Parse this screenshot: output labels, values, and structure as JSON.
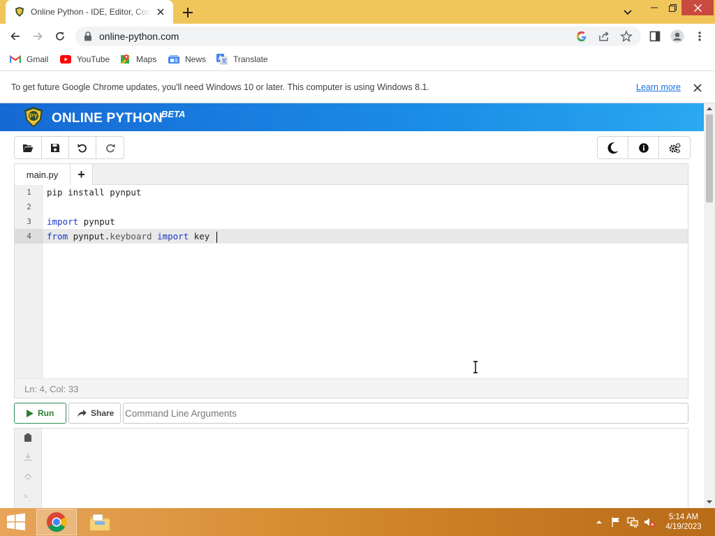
{
  "browser": {
    "tab_title": "Online Python - IDE, Editor, Compiler, Interpreter",
    "url": "online-python.com",
    "bookmarks": [
      {
        "label": "Gmail",
        "icon": "gmail-icon"
      },
      {
        "label": "YouTube",
        "icon": "youtube-icon"
      },
      {
        "label": "Maps",
        "icon": "maps-icon"
      },
      {
        "label": "News",
        "icon": "news-icon"
      },
      {
        "label": "Translate",
        "icon": "translate-icon"
      }
    ],
    "infobar": {
      "message": "To get future Google Chrome updates, you'll need Windows 10 or later. This computer is using Windows 8.1.",
      "link": "Learn more"
    }
  },
  "site": {
    "title": "ONLINE PYTHON",
    "badge": "BETA",
    "logo_text": "PY"
  },
  "editor": {
    "file_tab": "main.py",
    "add_tab": "+",
    "line_numbers": [
      "1",
      "2",
      "3",
      "4"
    ],
    "lines": [
      {
        "plain": "pip install pynput"
      },
      {
        "plain": ""
      },
      {
        "kw1": "import",
        "rest": " pynput"
      },
      {
        "kw1": "from",
        "mod": " pynput.",
        "attr": "keyboard",
        "kw2": " import",
        "rest": " key "
      }
    ],
    "status": "Ln: 4,  Col: 33"
  },
  "actions": {
    "run_label": "Run",
    "share_label": "Share",
    "cmd_placeholder": "Command Line Arguments"
  },
  "taskbar": {
    "time": "5:14 AM",
    "date": "4/19/2023"
  },
  "colors": {
    "tabstrip": "#f0c55a",
    "site_header": "#1a8ce6",
    "keyword": "#1a38c4",
    "run_green": "#2e7d32",
    "taskbar": "#d48a2e"
  }
}
